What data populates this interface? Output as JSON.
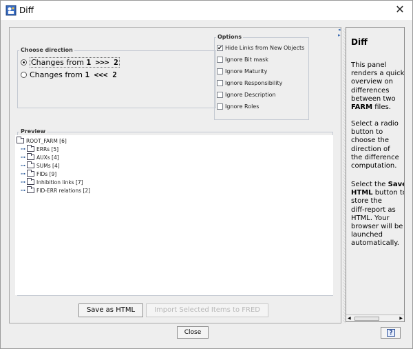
{
  "window": {
    "title": "Diff",
    "close_glyph": "✕"
  },
  "direction": {
    "title": "Choose direction",
    "option1": {
      "prefix": "Changes from ",
      "a": "1",
      "op": " >>> ",
      "b": "2",
      "checked": true
    },
    "option2": {
      "prefix": "Changes from ",
      "a": "1",
      "op": " <<< ",
      "b": "2",
      "checked": false
    }
  },
  "options": {
    "title": "Options",
    "items": [
      {
        "label": "Hide Links from New Objects",
        "checked": true
      },
      {
        "label": "Ignore Bit mask",
        "checked": false
      },
      {
        "label": "Ignore Maturity",
        "checked": false
      },
      {
        "label": "Ignore Responsibility",
        "checked": false
      },
      {
        "label": "Ignore Description",
        "checked": false
      },
      {
        "label": "Ignore Roles",
        "checked": false
      }
    ]
  },
  "preview": {
    "title": "Preview",
    "root": "ROOT_FARM [6]",
    "nodes": [
      "ERRs [5]",
      "AUXs [4]",
      "SUMs [4]",
      "FIDs [9]",
      "Inhibition links [7]",
      "FID-ERR relations [2]"
    ]
  },
  "buttons": {
    "save_html": "Save as HTML",
    "import_fred": "Import Selected Items to FRED",
    "close": "Close",
    "help": "?"
  },
  "info": {
    "title": "Diff",
    "para1": [
      "This panel",
      "renders a quick",
      "overview on",
      "differences",
      "between two"
    ],
    "para1_bold": "FARM",
    "para1_tail": " files.",
    "para2": [
      "Select a radio",
      "button to",
      "choose the",
      "direction of",
      "the difference",
      "computation."
    ],
    "para3_prefix": "Select the ",
    "para3_bold1": "Save",
    "para3_bold2": "HTML",
    "para3_rest": [
      "button to",
      "store the",
      "diff-report as",
      "HTML. Your",
      "browser will be",
      "launched",
      "automatically."
    ]
  },
  "icons": {
    "app": "diff-app-icon",
    "help": "help-icon"
  },
  "colors": {
    "accent": "#2a4f99",
    "disabled_text": "#b8b8b8"
  }
}
